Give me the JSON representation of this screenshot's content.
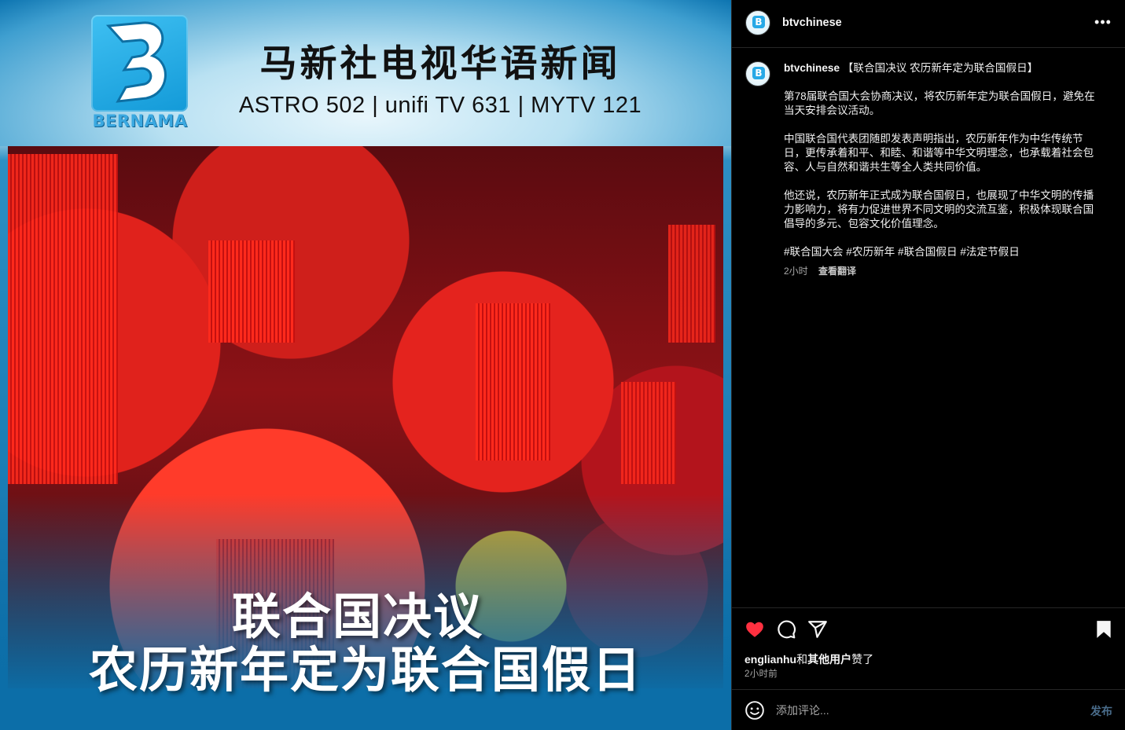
{
  "media": {
    "logo_word": "BERNAMA",
    "header_title": "马新社电视华语新闻",
    "header_sub": "ASTRO 502 | unifi TV 631 | MYTV 121",
    "caption_line1": "联合国决议",
    "caption_line2": "农历新年定为联合国假日",
    "colors": {
      "brand_blue": "#139ad8",
      "lantern_red": "#e4231e"
    }
  },
  "panel": {
    "header": {
      "username": "btvchinese",
      "more_icon": "more-horizontal-icon"
    },
    "post": {
      "username": "btvchinese",
      "headline": "【联合国决议 农历新年定为联合国假日】",
      "paragraphs": [
        "第78届联合国大会协商决议，将农历新年定为联合国假日，避免在当天安排会议活动。",
        "中国联合国代表团随即发表声明指出，农历新年作为中华传统节日，更传承着和平、和睦、和谐等中华文明理念，也承载着社会包容、人与自然和谐共生等全人类共同价值。",
        "他还说，农历新年正式成为联合国假日，也展现了中华文明的传播力影响力，将有力促进世界不同文明的交流互鉴，积极体现联合国倡导的多元、包容文化价值理念。"
      ],
      "hashtags": "#联合国大会 #农历新年 #联合国假日 #法定节假日",
      "time": "2小时",
      "translate": "查看翻译"
    },
    "actions": {
      "liked_by_user": "englianhu",
      "liked_by_joiner": "和",
      "liked_by_others": "其他用户",
      "liked_by_suffix": "赞了",
      "time": "2小时前",
      "like_color": "#ff3040"
    },
    "comment": {
      "placeholder": "添加评论...",
      "post_label": "发布"
    }
  }
}
